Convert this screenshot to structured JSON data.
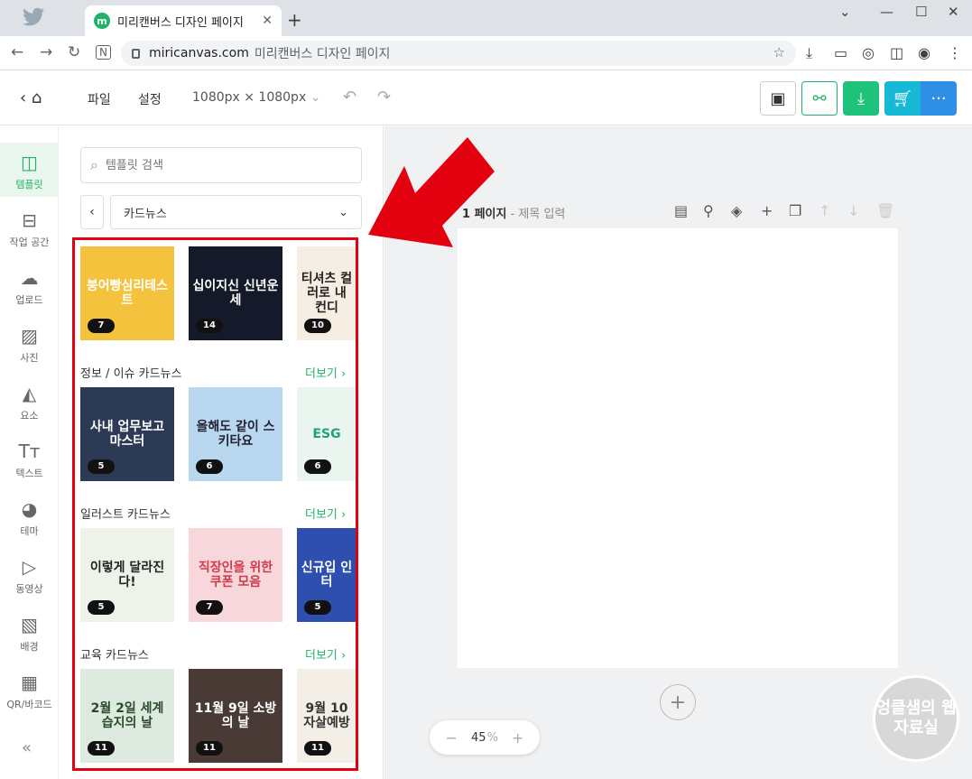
{
  "browser": {
    "tab_title": "미리캔버스 디자인 페이지",
    "url_host": "miricanvas.com",
    "url_title": "미리캔버스 디자인 페이지"
  },
  "header": {
    "file": "파일",
    "settings": "설정",
    "canvas_size": "1080px × 1080px"
  },
  "rail": {
    "items": [
      {
        "label": "템플릿",
        "icon": "template-icon",
        "glyph": "◫"
      },
      {
        "label": "작업 공간",
        "icon": "workspace-icon",
        "glyph": "⊟"
      },
      {
        "label": "업로드",
        "icon": "upload-icon",
        "glyph": "☁"
      },
      {
        "label": "사진",
        "icon": "photo-icon",
        "glyph": "▨"
      },
      {
        "label": "요소",
        "icon": "elements-icon",
        "glyph": "◭"
      },
      {
        "label": "텍스트",
        "icon": "text-icon",
        "glyph": "Tт"
      },
      {
        "label": "테마",
        "icon": "palette-icon",
        "glyph": "◕"
      },
      {
        "label": "동영상",
        "icon": "video-icon",
        "glyph": "▷"
      },
      {
        "label": "배경",
        "icon": "background-icon",
        "glyph": "▧"
      },
      {
        "label": "QR/바코드",
        "icon": "qr-icon",
        "glyph": "▦"
      }
    ]
  },
  "panel": {
    "search_placeholder": "템플릿 검색",
    "category": "카드뉴스",
    "more_label": "더보기",
    "top_row": [
      {
        "text": "붕어빵심리테스트",
        "count": "7",
        "bg": "#f4c23c",
        "fg": "#fff"
      },
      {
        "text": "십이지신 신년운세",
        "count": "14",
        "bg": "#141a2a",
        "fg": "#fff"
      },
      {
        "text": "티셔츠 컬러로 내 컨디",
        "count": "10",
        "bg": "#f6eee2",
        "fg": "#222"
      }
    ],
    "sections": [
      {
        "title": "정보 / 이슈 카드뉴스",
        "thumbs": [
          {
            "text": "사내 업무보고 마스터",
            "count": "5",
            "bg": "#2d3a55",
            "fg": "#fff"
          },
          {
            "text": "올해도 같이 스키타요",
            "count": "6",
            "bg": "#b9d7ef",
            "fg": "#223"
          },
          {
            "text": "ESG",
            "count": "6",
            "bg": "#eaf5ef",
            "fg": "#1fa37a"
          }
        ]
      },
      {
        "title": "일러스트 카드뉴스",
        "thumbs": [
          {
            "text": "이렇게 달라진다!",
            "count": "5",
            "bg": "#eef3ea",
            "fg": "#222"
          },
          {
            "text": "직장인을 위한 쿠폰 모음",
            "count": "7",
            "bg": "#f7d7dc",
            "fg": "#d23a4a"
          },
          {
            "text": "신규입 인터",
            "count": "5",
            "bg": "#2f4fb0",
            "fg": "#fff"
          }
        ]
      },
      {
        "title": "교육 카드뉴스",
        "thumbs": [
          {
            "text": "2월 2일 세계 습지의 날",
            "count": "11",
            "bg": "#dceadf",
            "fg": "#2a4a2a"
          },
          {
            "text": "11월 9일 소방의 날",
            "count": "11",
            "bg": "#4a3a35",
            "fg": "#fff"
          },
          {
            "text": "9월 10 자살예방",
            "count": "11",
            "bg": "#f3efe6",
            "fg": "#333"
          }
        ]
      }
    ]
  },
  "canvas": {
    "page_number": "1 페이지",
    "title_placeholder": " - 제목 입력",
    "zoom": "45",
    "zoom_unit": "%"
  },
  "watermark": "엉클샘의 웹자료실",
  "colors": {
    "brand_green": "#1fb36a",
    "annotation_red": "#e3000f"
  }
}
